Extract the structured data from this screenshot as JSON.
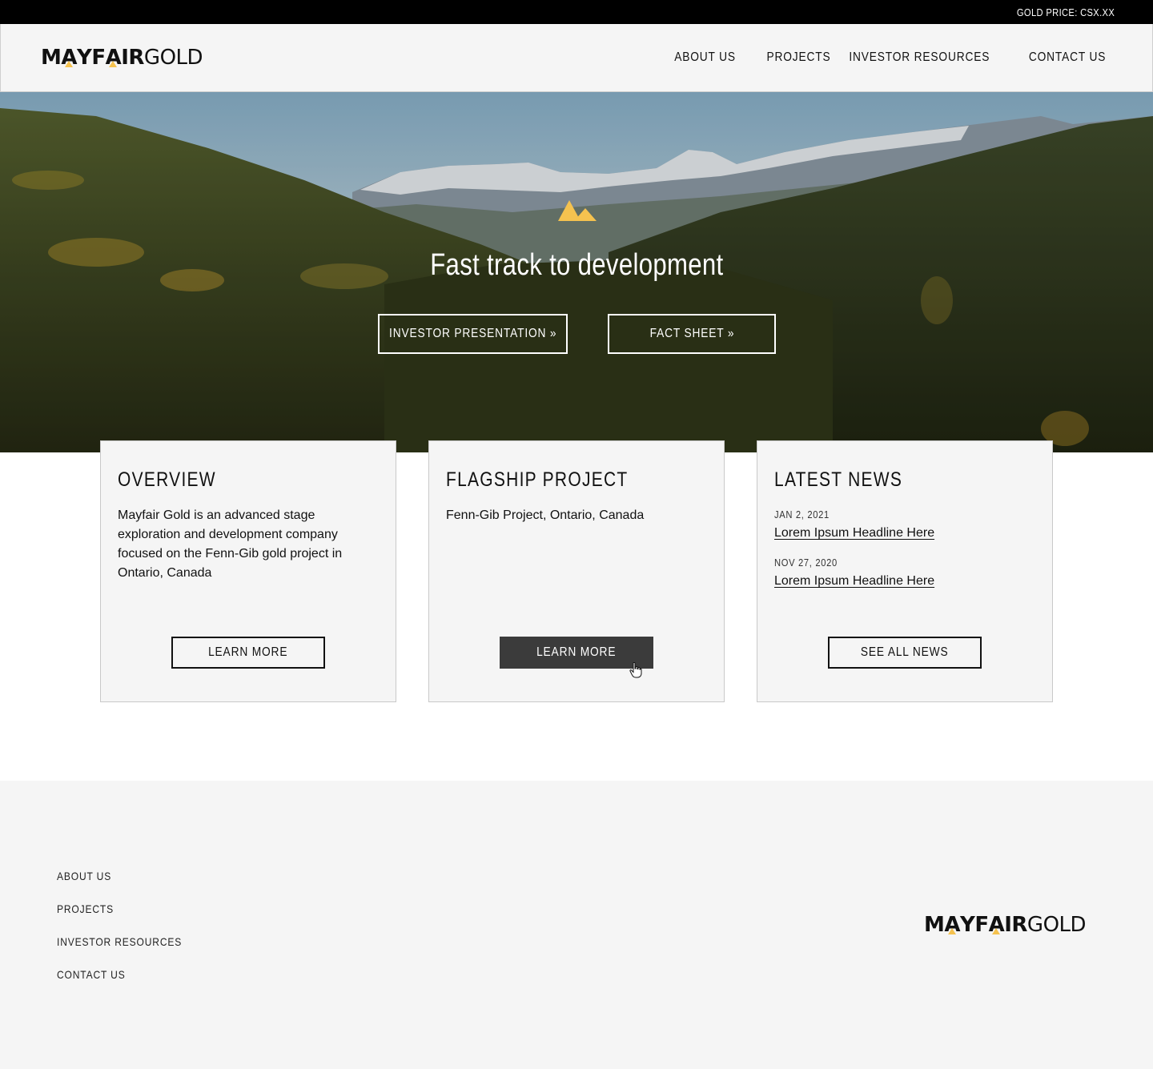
{
  "topbar": {
    "gold_price": "GOLD PRICE: CSX.XX"
  },
  "brand": {
    "name_bold": "MAYFAIR",
    "name_light": "GOLD",
    "accent": "#f5c24f"
  },
  "nav": {
    "items": [
      {
        "label": "ABOUT US"
      },
      {
        "label": "PROJECTS"
      },
      {
        "label": "INVESTOR RESOURCES"
      },
      {
        "label": "CONTACT US"
      }
    ]
  },
  "hero": {
    "icon": "mountain-icon",
    "title": "Fast track to development",
    "buttons": [
      {
        "label": "INVESTOR PRESENTATION »"
      },
      {
        "label": "FACT SHEET »"
      }
    ]
  },
  "cards": [
    {
      "title": "OVERVIEW",
      "text": "Mayfair Gold is an advanced stage exploration and development company focused on the Fenn-Gib gold project in Ontario, Canada",
      "button": "LEARN MORE"
    },
    {
      "title": "FLAGSHIP PROJECT",
      "text": "Fenn-Gib Project, Ontario, Canada",
      "button": "LEARN MORE"
    },
    {
      "title": "LATEST NEWS",
      "news": [
        {
          "date": "JAN 2, 2021",
          "headline": "Lorem Ipsum Headline Here"
        },
        {
          "date": "NOV 27, 2020",
          "headline": "Lorem Ipsum Headline Here"
        }
      ],
      "button": "SEE ALL NEWS"
    }
  ],
  "footer": {
    "links": [
      {
        "label": "ABOUT US"
      },
      {
        "label": "PROJECTS"
      },
      {
        "label": "INVESTOR RESOURCES"
      },
      {
        "label": "CONTACT US"
      }
    ]
  }
}
